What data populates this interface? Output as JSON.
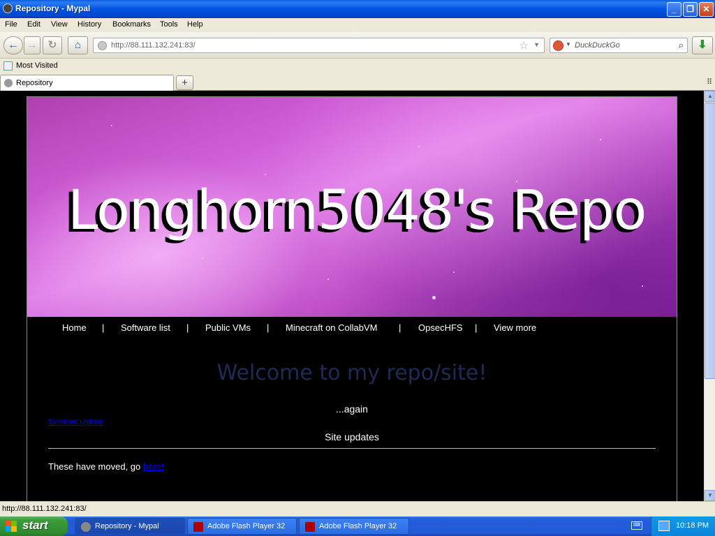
{
  "window": {
    "title": "Repository - Mypal",
    "buttons": {
      "minimize": "_",
      "maximize": "❐",
      "close": "✕"
    }
  },
  "menu": [
    "File",
    "Edit",
    "View",
    "History",
    "Bookmarks",
    "Tools",
    "Help"
  ],
  "navbar": {
    "url": "http://88.111.132.241:83/",
    "search_placeholder": "DuckDuckGo"
  },
  "bookmarks": {
    "most_visited": "Most Visited"
  },
  "tabs": [
    {
      "label": "Repository"
    }
  ],
  "site": {
    "banner_title": "Longhorn5048's Repo",
    "nav": [
      "Home",
      "|",
      "Software list",
      "|",
      "Public VMs",
      "|",
      "Minecraft on CollabVM",
      "|",
      "OpsecHFS",
      "|",
      "View more"
    ],
    "welcome": "Welcome to my repo/site!",
    "again": "...again",
    "services_link": "Services uptime",
    "site_updates": "Site updates",
    "moved_text": "These have moved, go ",
    "moved_link": "here!"
  },
  "statusbar": {
    "text": "http://88.111.132.241:83/"
  },
  "taskbar": {
    "start": "start",
    "tasks": [
      {
        "label": "Repository - Mypal"
      },
      {
        "label": "Adobe Flash Player 32"
      },
      {
        "label": "Adobe Flash Player 32"
      }
    ],
    "clock": "10:18 PM"
  },
  "colors": {
    "xp_blue": "#0054e3",
    "welcome_text": "#1f2a55",
    "link": "#0000ee",
    "banner_pink": "#d060d8"
  }
}
